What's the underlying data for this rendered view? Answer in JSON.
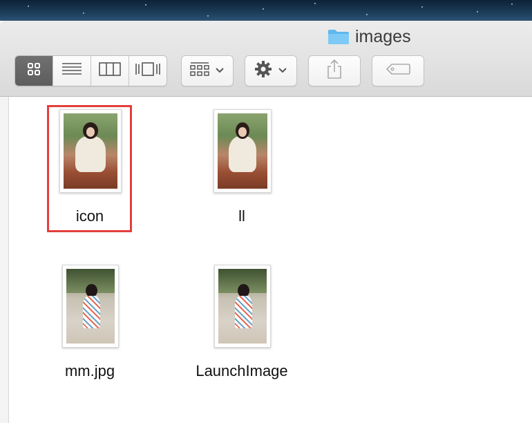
{
  "window": {
    "title": "images",
    "title_icon": "folder-icon"
  },
  "toolbar": {
    "view_modes": [
      {
        "name": "icon-view",
        "icon": "grid-icon",
        "active": true
      },
      {
        "name": "list-view",
        "icon": "list-icon",
        "active": false
      },
      {
        "name": "column-view",
        "icon": "columns-icon",
        "active": false
      },
      {
        "name": "cover-flow-view",
        "icon": "cover-flow-icon",
        "active": false
      }
    ],
    "arrange_icon": "arrange-grid-icon",
    "action_icon": "gear-icon",
    "share_icon": "share-icon",
    "tag_icon": "tag-icon"
  },
  "files": [
    {
      "name": "icon",
      "kind": "portrait-photo",
      "selected": true
    },
    {
      "name": "ll",
      "kind": "portrait-photo",
      "selected": false
    },
    {
      "name": "mm.jpg",
      "kind": "dress-photo",
      "selected": false
    },
    {
      "name": "LaunchImage",
      "kind": "dress-photo",
      "selected": false
    }
  ],
  "colors": {
    "selection_border": "#e43e3b",
    "folder_blue": "#5fb7ec",
    "active_segment": "#666666"
  }
}
